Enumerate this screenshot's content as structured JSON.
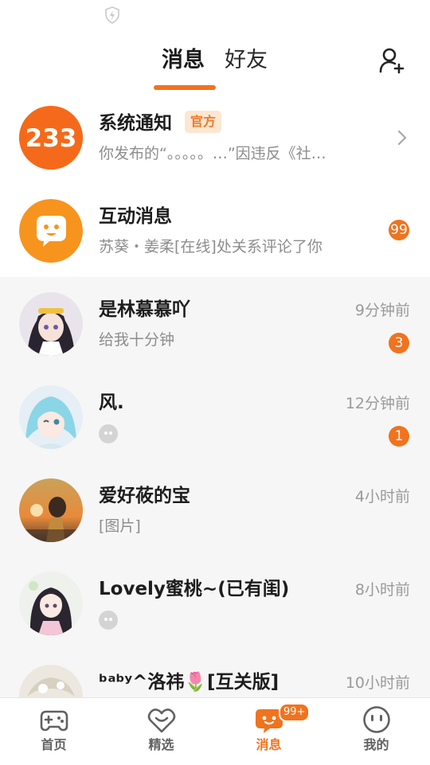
{
  "header": {
    "tab_messages": "消息",
    "tab_friends": "好友"
  },
  "conversations": [
    {
      "name": "系统通知",
      "tag": "官方",
      "preview": "你发布的“。。。。。…”因违反《社…"
    },
    {
      "name": "互动消息",
      "preview": "苏葵・姜柔[在线]处关系评论了你",
      "badge": "99"
    },
    {
      "name": "是林慕慕吖",
      "time": "9分钟前",
      "preview": "给我十分钟",
      "badge": "3"
    },
    {
      "name": "风.",
      "time": "12分钟前",
      "badge": "1"
    },
    {
      "name": "爱好莜的宝",
      "time": "4小时前",
      "preview": "[图片]"
    },
    {
      "name": "Lovely蜜桃~(已有闺)",
      "time": "8小时前"
    },
    {
      "name": "ᵇᵃᵇʸ^洛祎🌷[互关版]",
      "time": "10小时前"
    }
  ],
  "avatars": {
    "system_text": "233"
  },
  "tabbar": {
    "items": [
      {
        "label": "首页",
        "icon": "gamepad-icon"
      },
      {
        "label": "精选",
        "icon": "heart-badge-icon"
      },
      {
        "label": "消息",
        "icon": "chat-icon",
        "badge": "99+"
      },
      {
        "label": "我的",
        "icon": "face-icon"
      }
    ],
    "active_index": 2
  },
  "colors": {
    "accent": "#f0731f",
    "background": "#f6f6f6"
  }
}
